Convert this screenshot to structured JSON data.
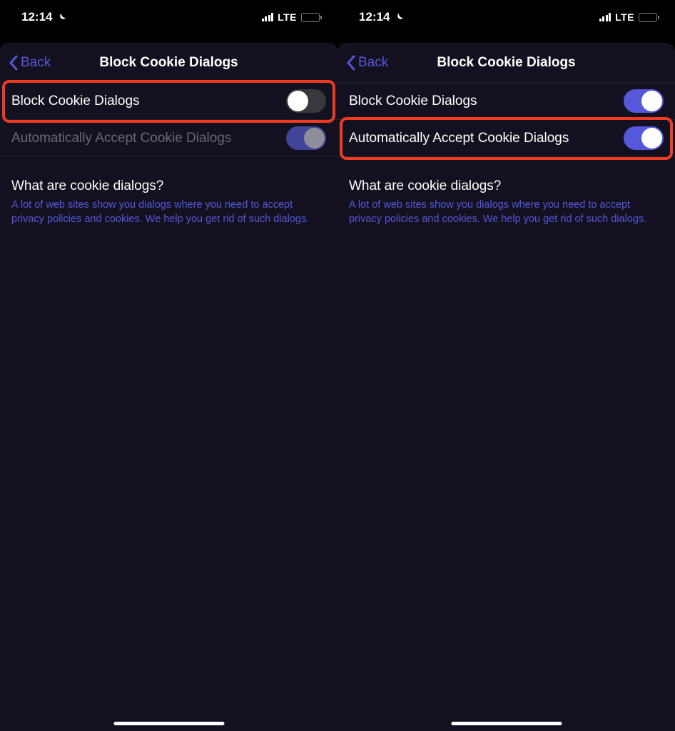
{
  "status": {
    "time": "12:14",
    "network_label": "LTE"
  },
  "nav": {
    "back_label": "Back",
    "title": "Block Cookie Dialogs"
  },
  "rows": {
    "block_label": "Block Cookie Dialogs",
    "auto_accept_label": "Automatically Accept Cookie Dialogs"
  },
  "help": {
    "title": "What are cookie dialogs?",
    "body": "A lot of web sites show you dialogs where you need to accept privacy policies and cookies. We help you get rid of such dialogs."
  },
  "colors": {
    "accent": "#5558da",
    "highlight": "#ef3b24",
    "sheet_bg": "#13111f",
    "battery_low": "#ffd60a"
  },
  "screens": [
    {
      "block_toggle_on": false,
      "auto_accept_enabled": false,
      "auto_accept_toggle_on": true,
      "highlight_row": "block"
    },
    {
      "block_toggle_on": true,
      "auto_accept_enabled": true,
      "auto_accept_toggle_on": true,
      "highlight_row": "auto_accept"
    }
  ]
}
